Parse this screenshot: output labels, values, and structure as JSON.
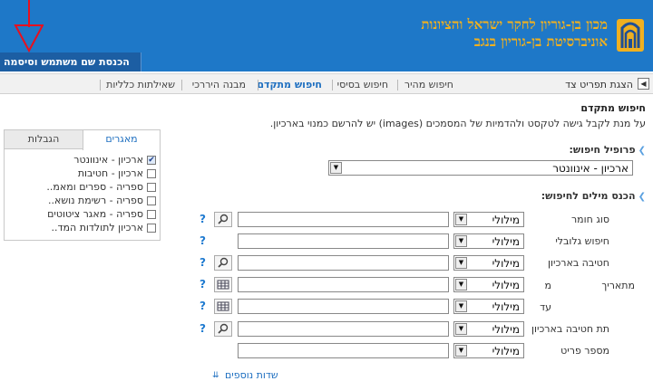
{
  "header": {
    "institution_line1": "מכון בן-גוריון לחקר ישראל והציונות",
    "institution_line2": "אוניברסיטת בן-גוריון בנגב",
    "login_tab": "הכנסת שם משתמש וסיסמה",
    "bg_color": "#1e78c8",
    "accent_color": "#f0b020",
    "arrow_color": "#e8101e"
  },
  "nav": {
    "jump_label": "הצגת תפריט צד",
    "items": [
      {
        "label": "חיפוש מהיר",
        "active": false
      },
      {
        "label": "חיפוש בסיסי",
        "active": false
      },
      {
        "label": "חיפוש מתקדם",
        "active": true
      },
      {
        "label": "מבנה היררכי",
        "active": false
      },
      {
        "label": "שאילתות כלליות",
        "active": false
      }
    ]
  },
  "main": {
    "title": "חיפוש מתקדם",
    "description": "על מנת לקבל גישה לטקסט ולהדמיות של המסמכים (images) יש להרשם כמנוי בארכיון.",
    "profile_heading": "פרופיל חיפוש:",
    "profile_value": "ארכיון - אינוונטר",
    "keywords_heading": "הכנס מילים לחיפוש:",
    "rows": [
      {
        "label": "סוג חומר",
        "operator": "מילולי",
        "value": "",
        "icon": "search-icon",
        "help": "?"
      },
      {
        "label": "חיפוש גלובלי",
        "operator": "מילולי",
        "value": "",
        "icon": "",
        "help": "?"
      },
      {
        "label": "חטיבה בארכיון",
        "operator": "מילולי",
        "value": "",
        "icon": "search-icon",
        "help": "?"
      },
      {
        "label": "מתאריך",
        "sublabel": "מ",
        "operator": "מילולי",
        "value": "",
        "icon": "calendar-icon",
        "help": "?"
      },
      {
        "label": "",
        "sublabel": "עד",
        "operator": "מילולי",
        "value": "",
        "icon": "calendar-icon",
        "help": "?"
      },
      {
        "label": "תת חטיבה בארכיון",
        "operator": "מילולי",
        "value": "",
        "icon": "search-icon",
        "help": "?"
      },
      {
        "label": "מספר פריט",
        "operator": "מילולי",
        "value": "",
        "icon": "",
        "help": ""
      }
    ],
    "more_fields": "שדות נוספים"
  },
  "panel": {
    "tab_databases": "מאגרים",
    "tab_limits": "הגבלות",
    "databases": [
      {
        "label": "ארכיון - אינוונטר",
        "checked": true
      },
      {
        "label": "ארכיון - חטיבות",
        "checked": false
      },
      {
        "label": "ספריה - ספרים ומאמ..",
        "checked": false
      },
      {
        "label": "ספריה - רשימת נושא..",
        "checked": false
      },
      {
        "label": "ספריה - מאגר ציטוטים",
        "checked": false
      },
      {
        "label": "ארכיון לתולדות המד..",
        "checked": false
      }
    ]
  }
}
